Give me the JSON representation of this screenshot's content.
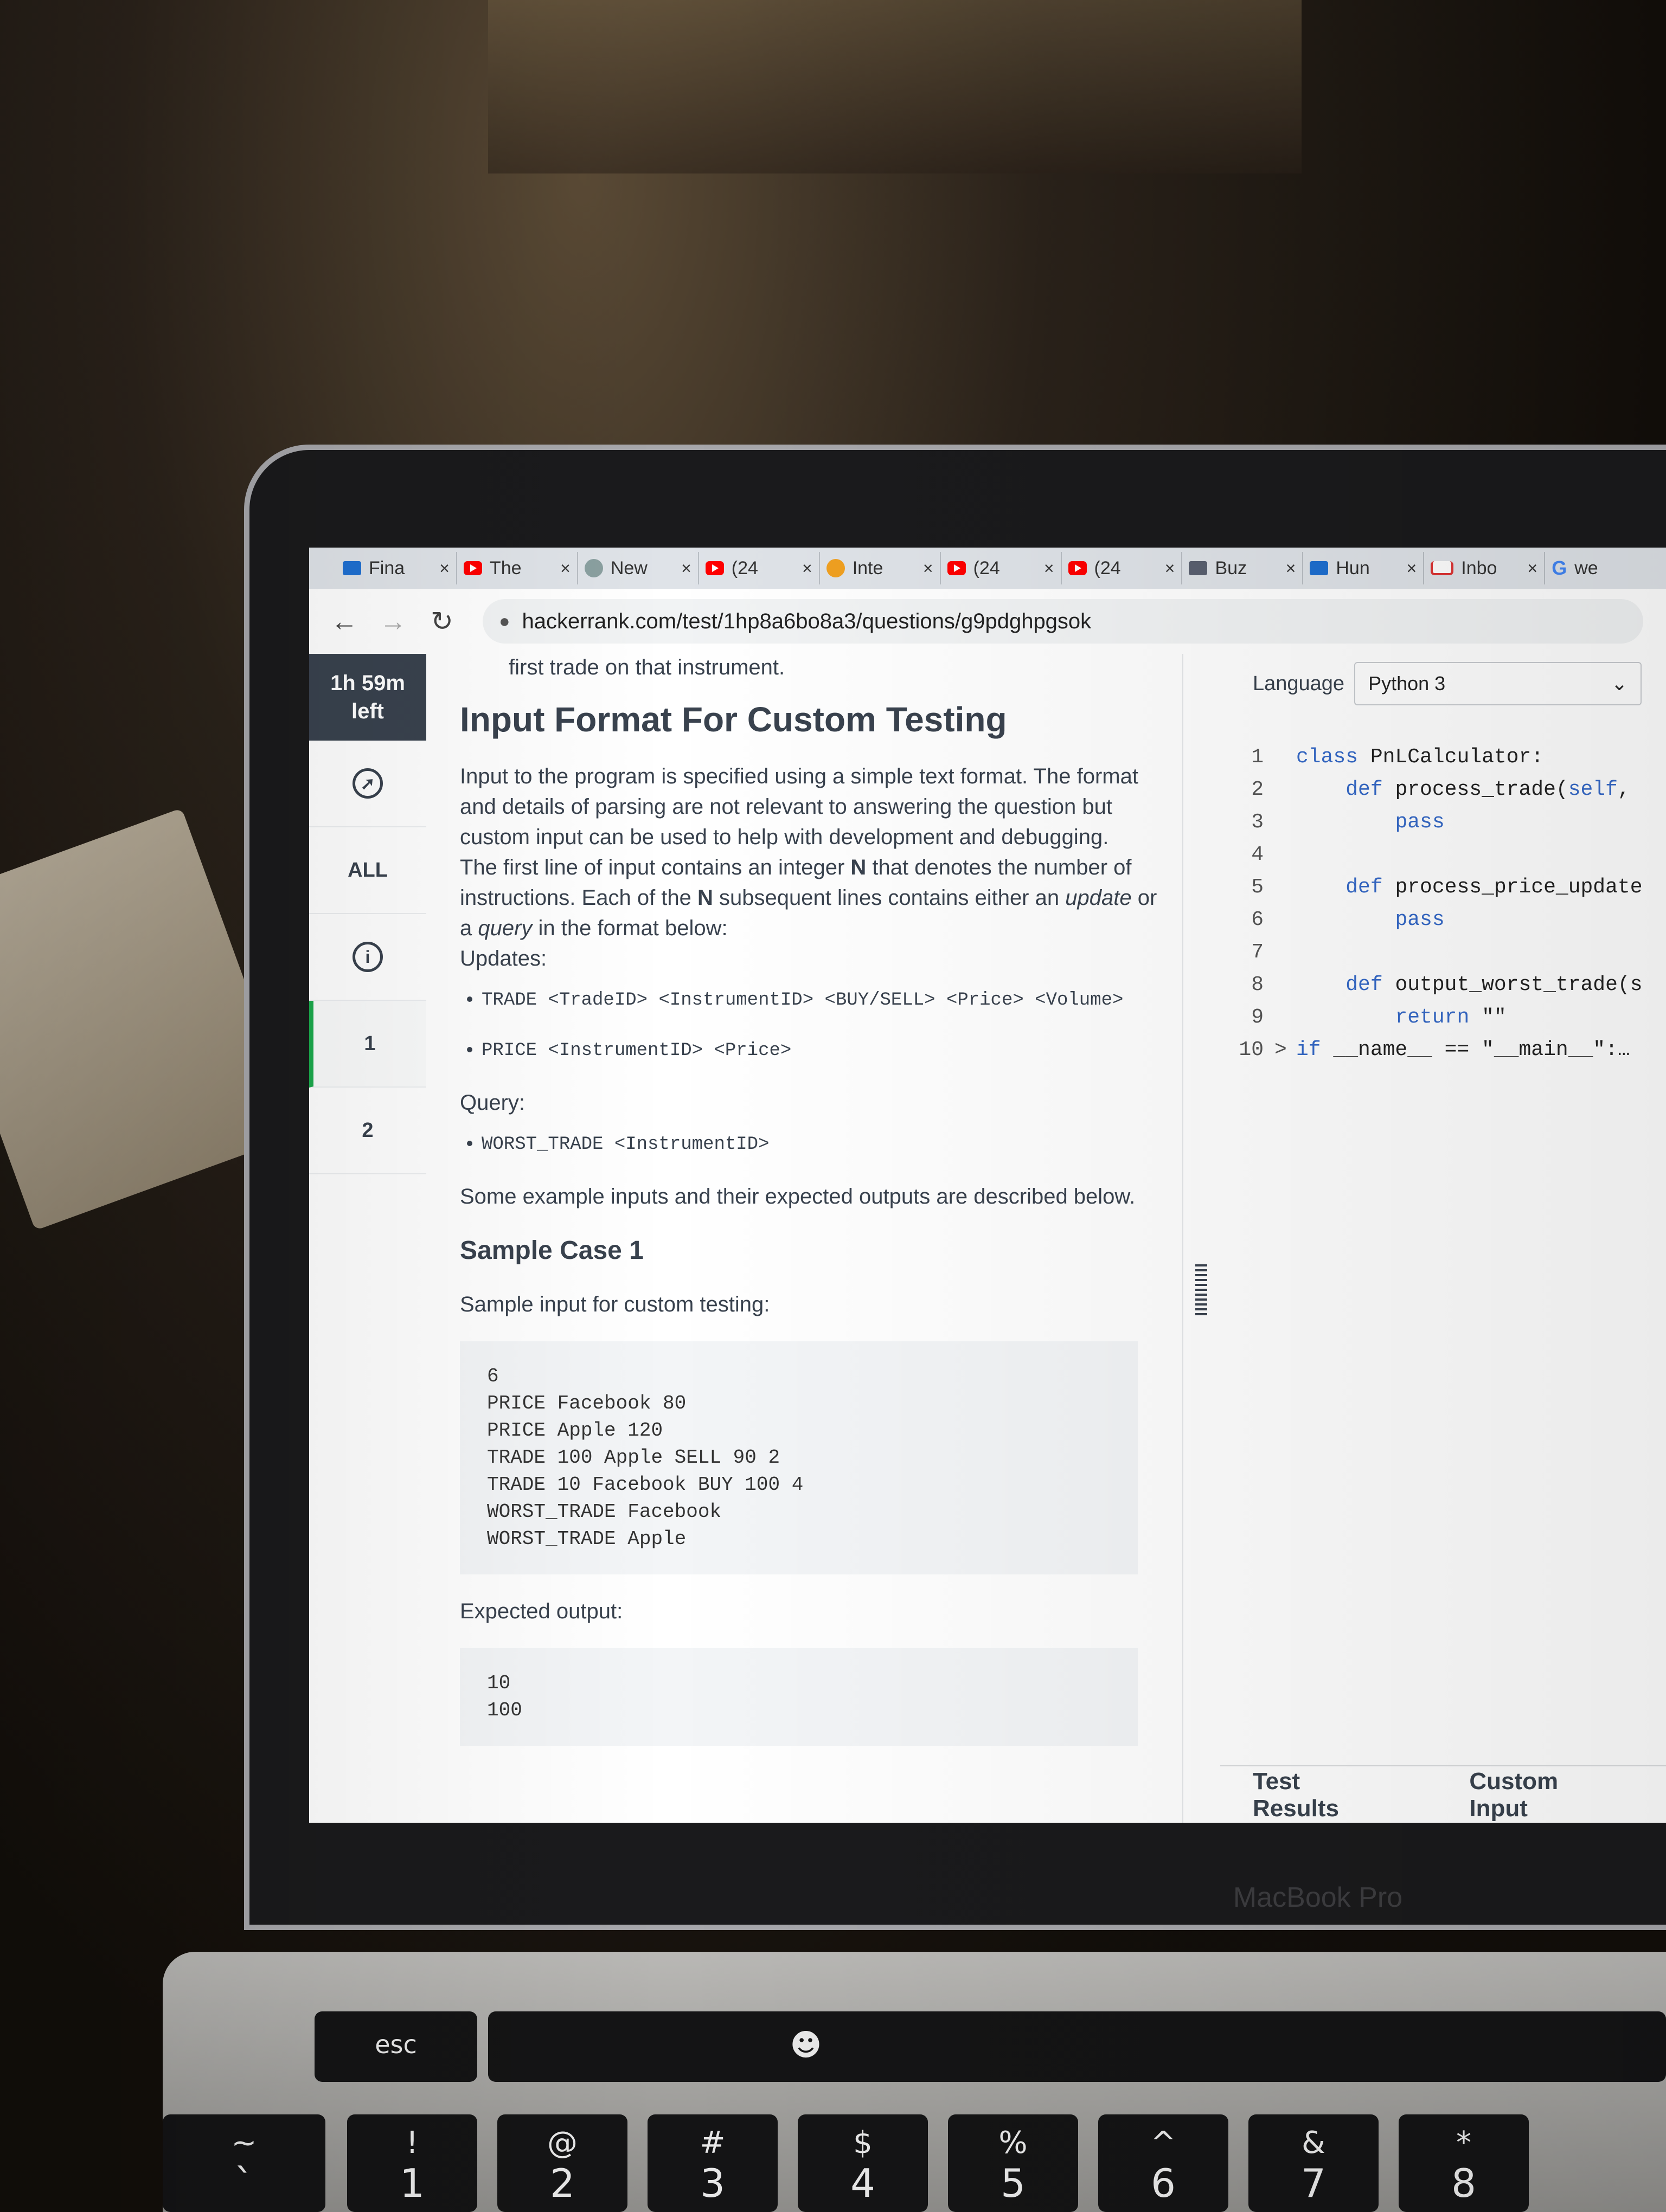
{
  "browser": {
    "tabs": [
      {
        "title": "Fina",
        "icon": "blue-board-icon"
      },
      {
        "title": "The",
        "icon": "youtube-icon"
      },
      {
        "title": "New",
        "icon": "chatgpt-icon"
      },
      {
        "title": "(24",
        "icon": "youtube-icon"
      },
      {
        "title": "Inte",
        "icon": "orange-circle-icon"
      },
      {
        "title": "(24",
        "icon": "youtube-icon"
      },
      {
        "title": "(24",
        "icon": "youtube-icon"
      },
      {
        "title": "Buz",
        "icon": "buzz-icon"
      },
      {
        "title": "Hun",
        "icon": "blue-square-icon"
      },
      {
        "title": "Inbo",
        "icon": "gmail-icon"
      },
      {
        "title": "we",
        "icon": "google-icon"
      }
    ],
    "tab_close": "×",
    "url": "hackerrank.com/test/1hp8a6bo8a3/questions/g9pdghpgsok"
  },
  "rail": {
    "timer_line1": "1h 59m",
    "timer_line2": "left",
    "all_label": "ALL",
    "info_label": "i",
    "question_1": "1",
    "question_2": "2"
  },
  "problem": {
    "cut_line": "first trade on that instrument.",
    "section_title": "Input Format For Custom Testing",
    "para1": "Input to the program is specified using a simple text format. The format and details of parsing are not relevant to answering the question but custom input can be used to help with development and debugging.",
    "para2_a": "The first line of input contains an integer ",
    "para2_n": "N",
    "para2_b": " that denotes the number of instructions. Each of the ",
    "para2_n2": "N",
    "para2_c": " subsequent lines contains either an ",
    "para2_update": "update",
    "para2_d": " or a ",
    "para2_query": "query",
    "para2_e": " in the format below:",
    "updates_label": "Updates:",
    "update_items": [
      "TRADE <TradeID> <InstrumentID> <BUY/SELL> <Price> <Volume>",
      "PRICE <InstrumentID> <Price>"
    ],
    "query_label": "Query:",
    "query_items": [
      "WORST_TRADE <InstrumentID>"
    ],
    "examples_text": "Some example inputs and their expected outputs are described below.",
    "sample_title": "Sample Case 1",
    "sample_input_label": "Sample input for custom testing:",
    "sample_input": "6\nPRICE Facebook 80\nPRICE Apple 120\nTRADE 100 Apple SELL 90 2\nTRADE 10 Facebook BUY 100 4\nWORST_TRADE Facebook\nWORST_TRADE Apple",
    "expected_output_label": "Expected output:",
    "expected_output": "10\n100"
  },
  "editor": {
    "language_label": "Language",
    "language_value": "Python 3",
    "code_lines": [
      {
        "n": "1",
        "fold": "",
        "text": "class PnLCalculator:"
      },
      {
        "n": "2",
        "fold": "",
        "text": "    def process_trade(self,"
      },
      {
        "n": "3",
        "fold": "",
        "text": "        pass"
      },
      {
        "n": "4",
        "fold": "",
        "text": ""
      },
      {
        "n": "5",
        "fold": "",
        "text": "    def process_price_update"
      },
      {
        "n": "6",
        "fold": "",
        "text": "        pass"
      },
      {
        "n": "7",
        "fold": "",
        "text": ""
      },
      {
        "n": "8",
        "fold": "",
        "text": "    def output_worst_trade(s"
      },
      {
        "n": "9",
        "fold": "",
        "text": "        return \"\""
      },
      {
        "n": "10",
        "fold": ">",
        "text": "if __name__ == \"__main__\":…"
      }
    ],
    "test_results_tab": "Test Results",
    "custom_input_tab": "Custom Input"
  },
  "device": {
    "brand": "MacBook Pro",
    "keys_fn": [
      "esc"
    ],
    "keys_num": [
      {
        "top": "~",
        "bot": "`"
      },
      {
        "top": "!",
        "bot": "1"
      },
      {
        "top": "@",
        "bot": "2"
      },
      {
        "top": "#",
        "bot": "3"
      },
      {
        "top": "$",
        "bot": "4"
      },
      {
        "top": "%",
        "bot": "5"
      },
      {
        "top": "^",
        "bot": "6"
      },
      {
        "top": "&",
        "bot": "7"
      },
      {
        "top": "*",
        "bot": "8"
      }
    ]
  }
}
